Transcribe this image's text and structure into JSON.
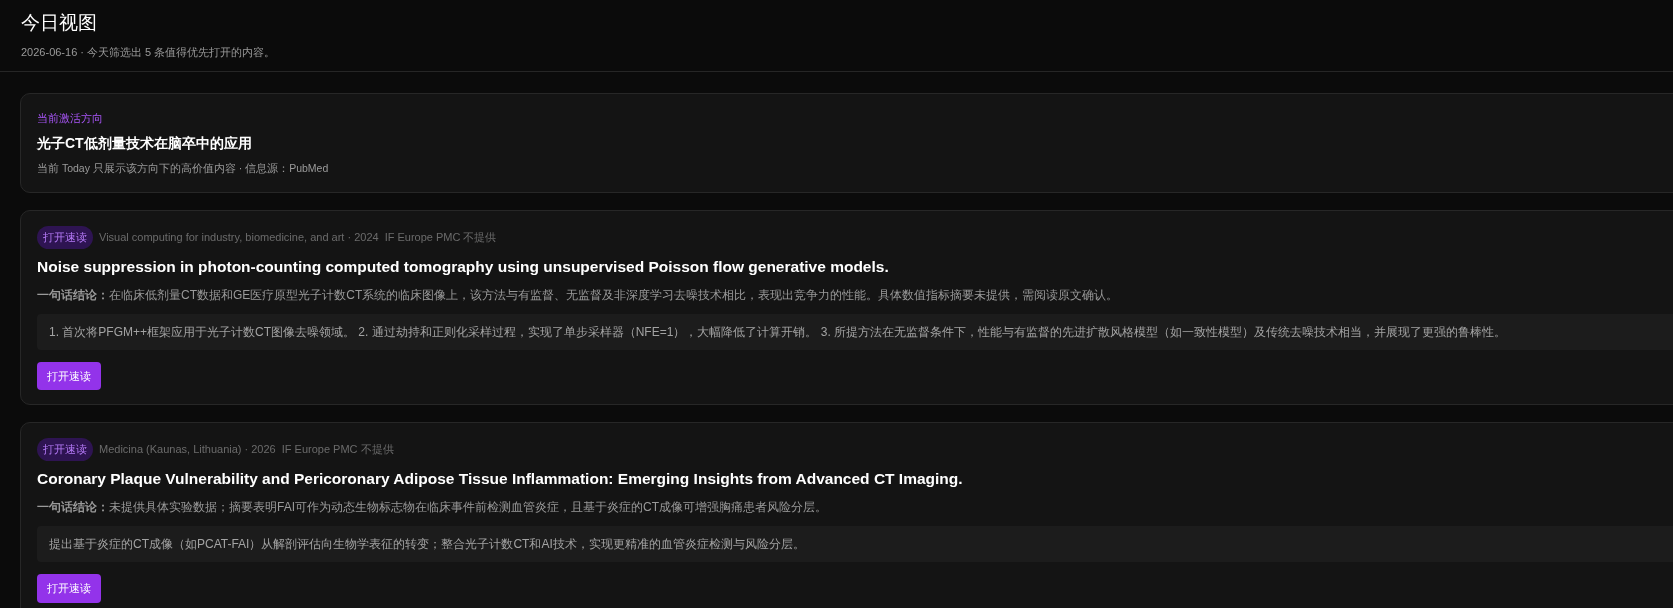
{
  "header": {
    "title": "今日视图",
    "subtitle": "2026-06-16 · 今天筛选出 5 条值得优先打开的内容。"
  },
  "focus": {
    "label": "当前激活方向",
    "title": "光子CT低剂量技术在脑卒中的应用",
    "note": "当前 Today 只展示该方向下的高价值内容 · 信息源：PubMed"
  },
  "papers": [
    {
      "tag": "打开速读",
      "meta": "Visual computing for industry, biomedicine, and art · 2024",
      "impact": "IF Europe PMC 不提供",
      "title": "Noise suppression in photon-counting computed tomography using unsupervised Poisson flow generative models.",
      "conclusion": "**一句话结论：**在临床低剂量CT数据和GE医疗原型光子计数CT系统的临床图像上，该方法与有监督、无监督及非深度学习去噪技术相比，表现出竞争力的性能。具体数值指标摘要未提供，需阅读原文确认。",
      "highlights": "1. 首次将PFGM++框架应用于光子计数CT图像去噪领域。 2. 通过劫持和正则化采样过程，实现了单步采样器（NFE=1），大幅降低了计算开销。 3. 所提方法在无监督条件下，性能与有监督的先进扩散风格模型（如一致性模型）及传统去噪技术相当，并展现了更强的鲁棒性。",
      "button": "打开速读"
    },
    {
      "tag": "打开速读",
      "meta": "Medicina (Kaunas, Lithuania) · 2026",
      "impact": "IF Europe PMC 不提供",
      "title": "Coronary Plaque Vulnerability and Pericoronary Adipose Tissue Inflammation: Emerging Insights from Advanced CT Imaging.",
      "conclusion": "**一句话结论：**未提供具体实验数据；摘要表明FAI可作为动态生物标志物在临床事件前检测血管炎症，且基于炎症的CT成像可增强胸痛患者风险分层。",
      "highlights": "提出基于炎症的CT成像（如PCAT-FAI）从解剖评估向生物学表征的转变；整合光子计数CT和AI技术，实现更精准的血管炎症检测与风险分层。",
      "button": "打开速读"
    }
  ]
}
